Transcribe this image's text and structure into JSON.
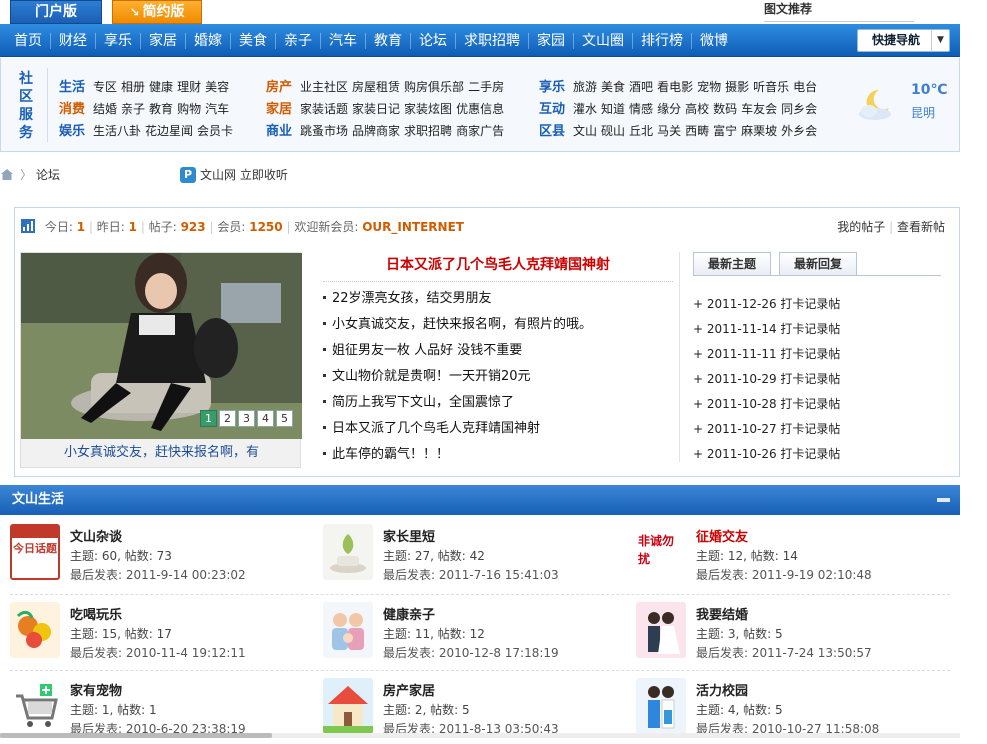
{
  "tabs": {
    "portal": "门户版",
    "simple": "简约版",
    "simple_icon": "↘"
  },
  "tuijian": "图文推荐",
  "nav": {
    "items": [
      "首页",
      "财经",
      "享乐",
      "家居",
      "婚嫁",
      "美食",
      "亲子",
      "汽车",
      "教育",
      "论坛",
      "求职招聘",
      "家园",
      "文山圈",
      "排行榜",
      "微博"
    ],
    "quick": "快捷导航"
  },
  "services": {
    "heading": "社区服务",
    "col1": [
      {
        "label": "生活",
        "links": [
          "专区",
          "相册",
          "健康",
          "理财",
          "美容"
        ]
      },
      {
        "label": "消费",
        "links": [
          "结婚",
          "亲子",
          "教育",
          "购物",
          "汽车"
        ]
      },
      {
        "label": "娱乐",
        "links": [
          "生活八卦",
          "花边星闻",
          "会员卡"
        ]
      }
    ],
    "col2": [
      {
        "label": "房产",
        "links": [
          "业主社区",
          "房屋租赁",
          "购房俱乐部",
          "二手房"
        ]
      },
      {
        "label": "家居",
        "links": [
          "家装话题",
          "家装日记",
          "家装炫图",
          "优惠信息"
        ]
      },
      {
        "label": "商业",
        "links": [
          "跳蚤市场",
          "品牌商家",
          "求职招聘",
          "商家广告"
        ]
      }
    ],
    "col3": [
      {
        "label": "享乐",
        "links": [
          "旅游",
          "美食",
          "酒吧",
          "看电影",
          "宠物",
          "摄影",
          "听音乐",
          "电台"
        ]
      },
      {
        "label": "互动",
        "links": [
          "灌水",
          "知道",
          "情感",
          "缘分",
          "高校",
          "数码",
          "车友会",
          "同乡会"
        ]
      },
      {
        "label": "区县",
        "links": [
          "文山",
          "砚山",
          "丘北",
          "马关",
          "西畴",
          "富宁",
          "麻栗坡",
          "外乡会"
        ]
      }
    ],
    "weather": {
      "temp": "10℃",
      "city": "昆明"
    }
  },
  "breadcrumb": {
    "current": "论坛",
    "fav_icon": "P",
    "fav_text": "文山网 立即收听"
  },
  "stats": {
    "today_label": "今日:",
    "today": "1",
    "yesterday_label": "昨日:",
    "yesterday": "1",
    "posts_label": "帖子:",
    "posts": "923",
    "members_label": "会员:",
    "members": "1250",
    "welcome_label": "欢迎新会员:",
    "newest": "OUR_INTERNET",
    "my_posts": "我的帖子",
    "view_new": "查看新帖"
  },
  "feature": {
    "caption": "小女真诚交友，赶快来报名啊，有",
    "pages": [
      "1",
      "2",
      "3",
      "4",
      "5"
    ]
  },
  "headlines": {
    "title": "日本又派了几个鸟毛人克拜靖国神射",
    "items": [
      "22岁漂亮女孩，结交男朋友",
      "小女真诚交友，赶快来报名啊，有照片的哦。",
      "姐征男友一枚 人品好 没钱不重要",
      "文山物价就是贵啊！一天开销20元",
      "简历上我写下文山，全国震惊了",
      "日本又派了几个鸟毛人克拜靖国神射",
      "此车停的霸气！！！"
    ]
  },
  "latest": {
    "tab_topics": "最新主题",
    "tab_replies": "最新回复",
    "items": [
      "+ 2011-12-26 打卡记录帖",
      "+ 2011-11-14 打卡记录帖",
      "+ 2011-11-11 打卡记录帖",
      "+ 2011-10-29 打卡记录帖",
      "+ 2011-10-28 打卡记录帖",
      "+ 2011-10-27 打卡记录帖",
      "+ 2011-10-26 打卡记录帖"
    ]
  },
  "section": {
    "title": "文山生活"
  },
  "forums": [
    {
      "name": "文山杂谈",
      "topics": "主题: 60, 帖数: 73",
      "last": "最后发表: 2011-9-14 00:23:02",
      "thumb_text": "今日话题"
    },
    {
      "name": "家长里短",
      "topics": "主题: 27, 帖数: 42",
      "last": "最后发表: 2011-7-16 15:41:03"
    },
    {
      "name": "征婚交友",
      "topics": "主题: 12, 帖数: 14",
      "last": "最后发表: 2011-9-19 02:10:48",
      "thumb_text": "非诚勿扰"
    },
    {
      "name": "吃喝玩乐",
      "topics": "主题: 15, 帖数: 17",
      "last": "最后发表: 2010-11-4 19:12:11"
    },
    {
      "name": "健康亲子",
      "topics": "主题: 11, 帖数: 12",
      "last": "最后发表: 2010-12-8 17:18:19"
    },
    {
      "name": "我要结婚",
      "topics": "主题: 3, 帖数: 5",
      "last": "最后发表: 2011-7-24 13:50:57"
    },
    {
      "name": "家有宠物",
      "topics": "主题: 1, 帖数: 1",
      "last": "最后发表: 2010-6-20 23:38:19"
    },
    {
      "name": "房产家居",
      "topics": "主题: 2, 帖数: 5",
      "last": "最后发表: 2011-8-13 03:50:43"
    },
    {
      "name": "活力校园",
      "topics": "主题: 4, 帖数: 5",
      "last": "最后发表: 2010-10-27 11:58:08"
    }
  ]
}
